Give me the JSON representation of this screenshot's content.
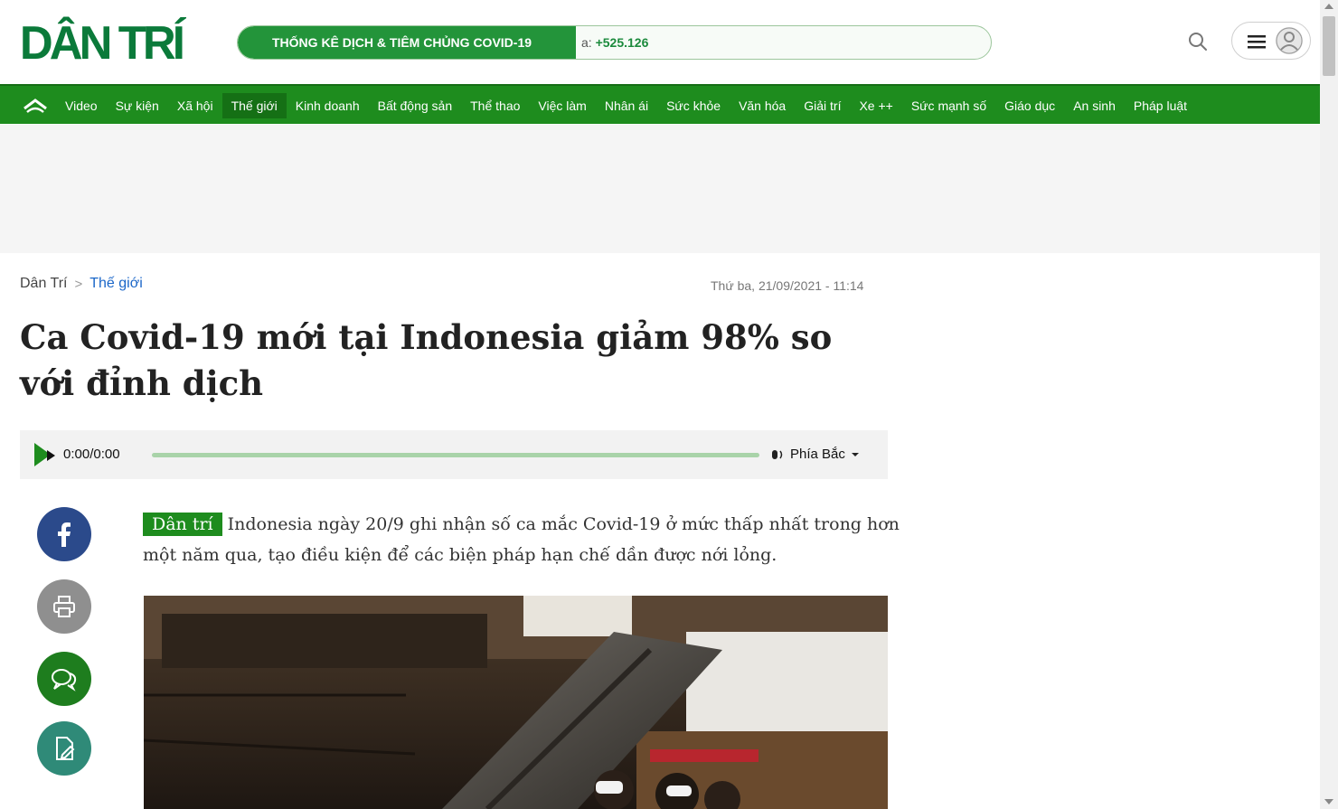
{
  "header": {
    "logo_text": "DÂN TRÍ",
    "covid": {
      "label": "THỐNG KÊ DỊCH & TIÊM CHỦNG COVID-19",
      "count_prefix": "a: ",
      "count_value": "+525.126"
    },
    "icons": {
      "search": "search-icon",
      "menu": "hamburger-menu-icon",
      "user": "user-avatar-icon"
    }
  },
  "nav": {
    "home_icon": "home-icon",
    "items": [
      {
        "label": "Video"
      },
      {
        "label": "Sự kiện"
      },
      {
        "label": "Xã hội"
      },
      {
        "label": "Thế giới"
      },
      {
        "label": "Kinh doanh"
      },
      {
        "label": "Bất động sản"
      },
      {
        "label": "Thể thao"
      },
      {
        "label": "Việc làm"
      },
      {
        "label": "Nhân ái"
      },
      {
        "label": "Sức khỏe"
      },
      {
        "label": "Văn hóa"
      },
      {
        "label": "Giải trí"
      },
      {
        "label": "Xe ++"
      },
      {
        "label": "Sức mạnh số"
      },
      {
        "label": "Giáo dục"
      },
      {
        "label": "An sinh"
      },
      {
        "label": "Pháp luật"
      }
    ],
    "active_label": "Thế giới"
  },
  "breadcrumb": {
    "home": "Dân Trí",
    "separator": ">",
    "category": "Thế giới"
  },
  "article": {
    "date": "Thứ ba, 21/09/2021 - 11:14",
    "title": "Ca Covid-19 mới tại Indonesia giảm 98% so với đỉnh dịch",
    "sapo_tag": "Dân trí",
    "sapo": "Indonesia ngày 20/9 ghi nhận số ca mắc Covid-19 ở mức thấp nhất trong hơn một năm qua, tạo điều kiện để các biện pháp hạn chế dần được nới lỏng."
  },
  "audio": {
    "time": "0:00/0:00",
    "voice": "Phía Bắc"
  },
  "share": {
    "facebook": "facebook-icon",
    "print": "print-icon",
    "comment": "comment-icon",
    "edit": "edit-icon"
  },
  "colors": {
    "brand_green": "#1e8c1e",
    "logo_green": "#0b7a3a",
    "link_blue": "#1a66c8",
    "facebook_blue": "#2b4a8b"
  }
}
